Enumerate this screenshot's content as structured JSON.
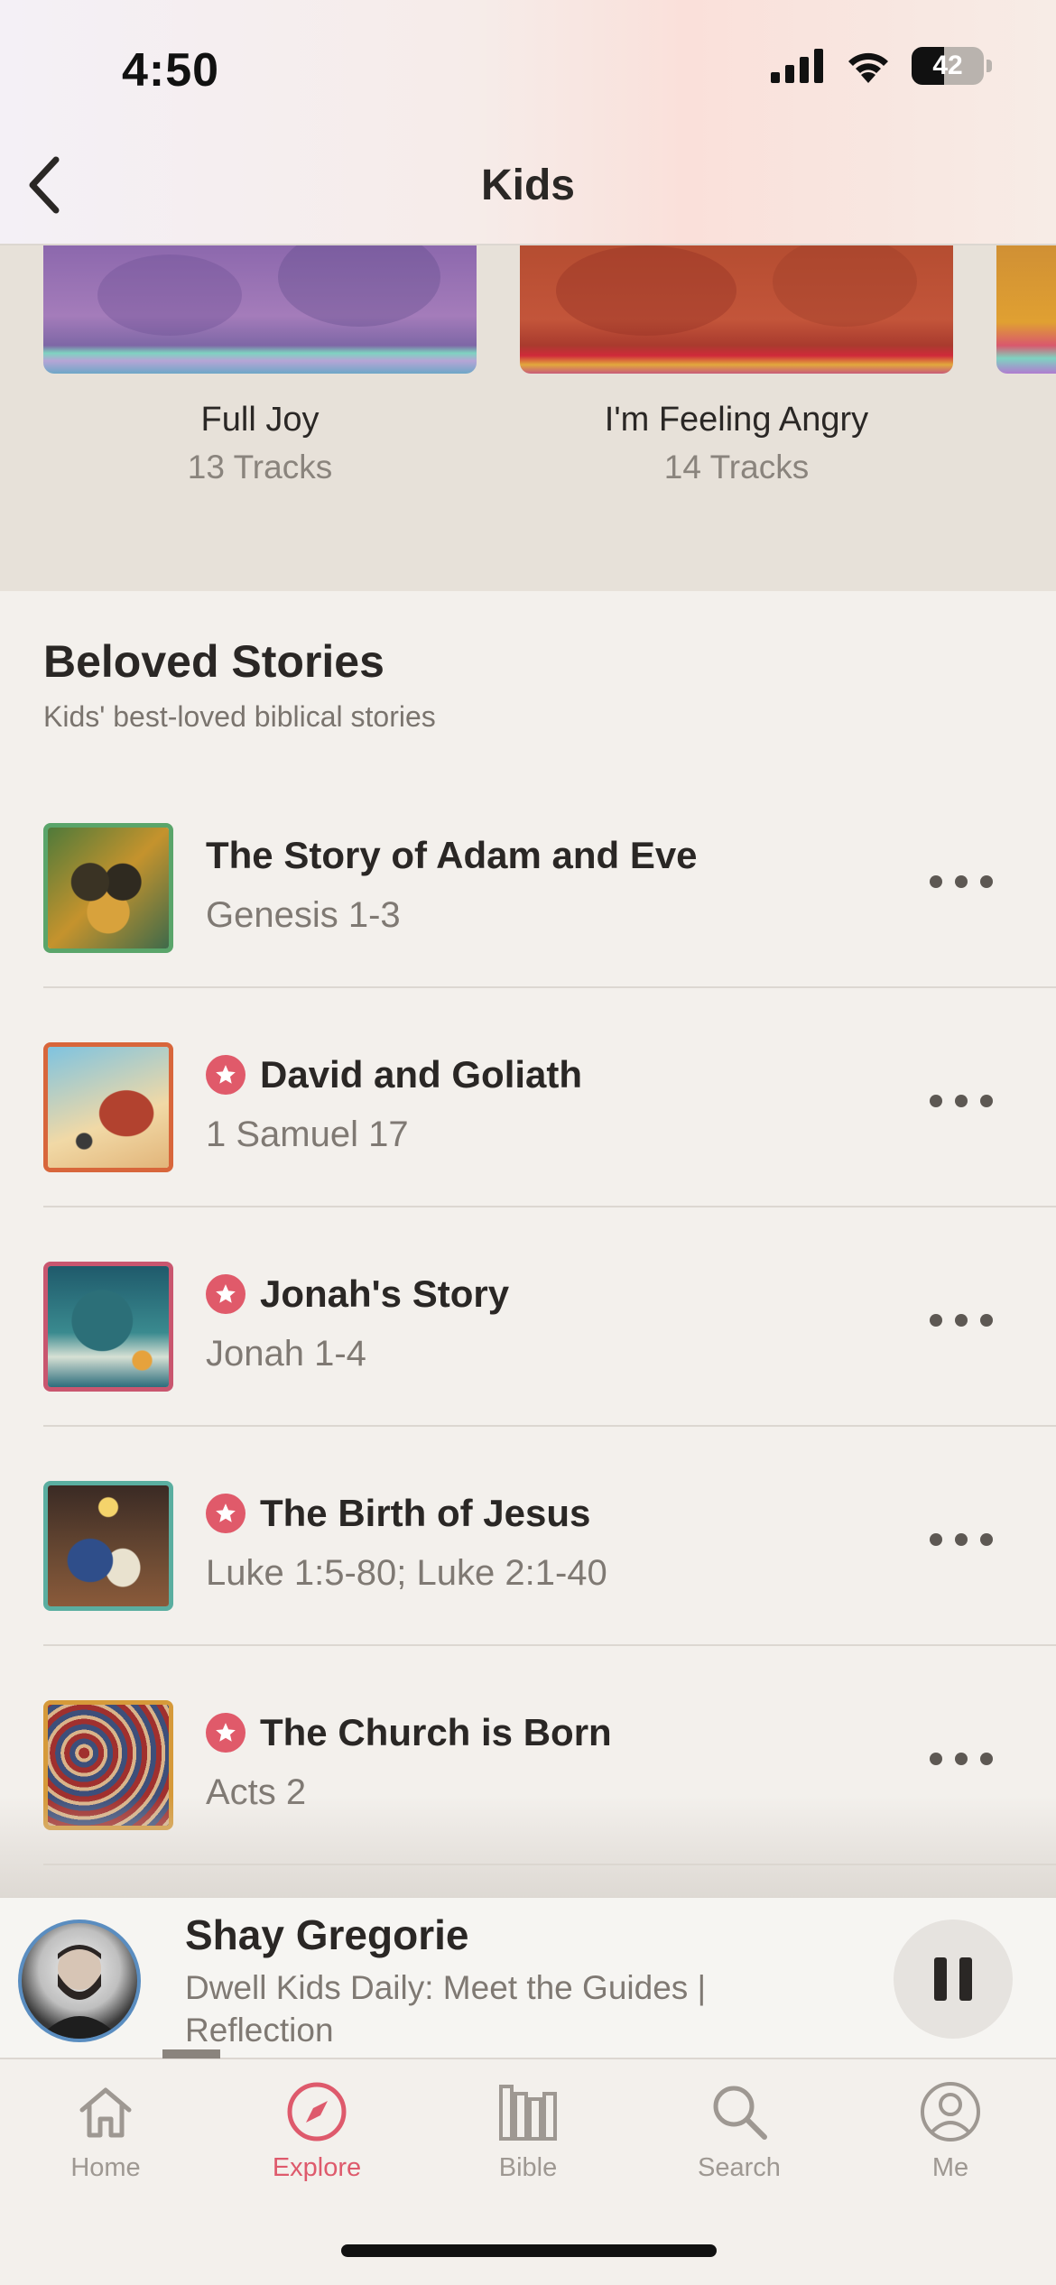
{
  "status_bar": {
    "time": "4:50",
    "battery": "42"
  },
  "header": {
    "title": "Kids",
    "back_icon": "chevron-left-icon"
  },
  "playlists": [
    {
      "title": "Full Joy",
      "tracks": "13 Tracks"
    },
    {
      "title": "I'm Feeling Angry",
      "tracks": "14 Tracks"
    }
  ],
  "section": {
    "title": "Beloved Stories",
    "subtitle": "Kids' best-loved biblical stories",
    "items": [
      {
        "title": "The Story of Adam and Eve",
        "reference": "Genesis 1-3",
        "starred": false,
        "frame_color": "#5aa56a"
      },
      {
        "title": "David and Goliath",
        "reference": "1 Samuel 17",
        "starred": true,
        "frame_color": "#d8663b"
      },
      {
        "title": "Jonah's Story",
        "reference": "Jonah 1-4",
        "starred": true,
        "frame_color": "#c9566f"
      },
      {
        "title": "The Birth of Jesus",
        "reference": "Luke 1:5-80; Luke 2:1-40",
        "starred": true,
        "frame_color": "#5aaea0"
      },
      {
        "title": "The Church is Born",
        "reference": "Acts 2",
        "starred": true,
        "frame_color": "#d69a3a"
      }
    ]
  },
  "player": {
    "title": "Shay Gregorie",
    "subtitle": "Dwell Kids Daily: Meet the Guides | Reflection",
    "state": "playing"
  },
  "tabs": [
    {
      "label": "Home",
      "icon": "home-icon",
      "active": false
    },
    {
      "label": "Explore",
      "icon": "compass-icon",
      "active": true
    },
    {
      "label": "Bible",
      "icon": "books-icon",
      "active": false
    },
    {
      "label": "Search",
      "icon": "search-icon",
      "active": false
    },
    {
      "label": "Me",
      "icon": "person-icon",
      "active": false
    }
  ],
  "colors": {
    "accent": "#de5a6c",
    "background": "#f3f0ec",
    "carousel_bg": "#e7e1d9"
  }
}
